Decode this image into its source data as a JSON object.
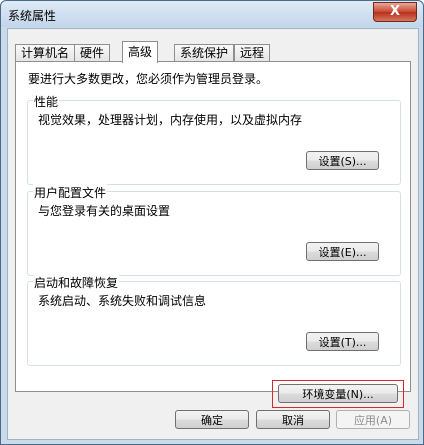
{
  "window": {
    "title": "系统属性",
    "close_label": "X"
  },
  "tabs": [
    {
      "label": "计算机名"
    },
    {
      "label": "硬件"
    },
    {
      "label": "高级"
    },
    {
      "label": "系统保护"
    },
    {
      "label": "远程"
    }
  ],
  "advanced": {
    "intro": "要进行大多数更改，您必须作为管理员登录。",
    "performance": {
      "title": "性能",
      "description": "视觉效果，处理器计划，内存使用，以及虚拟内存",
      "button": "设置(S)..."
    },
    "user_profiles": {
      "title": "用户配置文件",
      "description": "与您登录有关的桌面设置",
      "button": "设置(E)..."
    },
    "startup_recovery": {
      "title": "启动和故障恢复",
      "description": "系统启动、系统失败和调试信息",
      "button": "设置(T)..."
    },
    "env_button": "环境变量(N)..."
  },
  "footer": {
    "ok": "确定",
    "cancel": "取消",
    "apply": "应用(A)"
  }
}
